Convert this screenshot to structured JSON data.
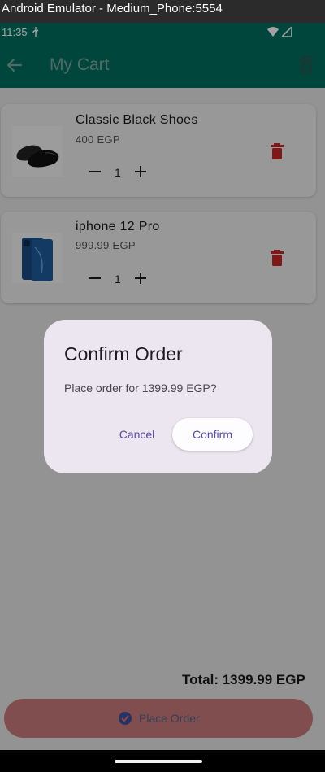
{
  "window": {
    "title": "Android Emulator - Medium_Phone:5554"
  },
  "status_bar": {
    "time": "11:35"
  },
  "app_bar": {
    "title": "My Cart"
  },
  "cart": {
    "items": [
      {
        "name": "Classic Black Shoes",
        "price": "400 EGP",
        "quantity": "1",
        "image": "black-shoes"
      },
      {
        "name": "iphone 12 Pro",
        "price": "999.99 EGP",
        "quantity": "1",
        "image": "iphone-12-pro"
      }
    ],
    "total": "Total: 1399.99 EGP",
    "place_order_label": "Place Order"
  },
  "dialog": {
    "title": "Confirm Order",
    "message": "Place order for 1399.99 EGP?",
    "cancel_label": "Cancel",
    "confirm_label": "Confirm"
  },
  "colors": {
    "primary": "#006e5e",
    "delete": "#c62828",
    "place_order": "#c97a7a",
    "dialog_bg": "#ece6f0",
    "dialog_action": "#5a4ba0"
  }
}
